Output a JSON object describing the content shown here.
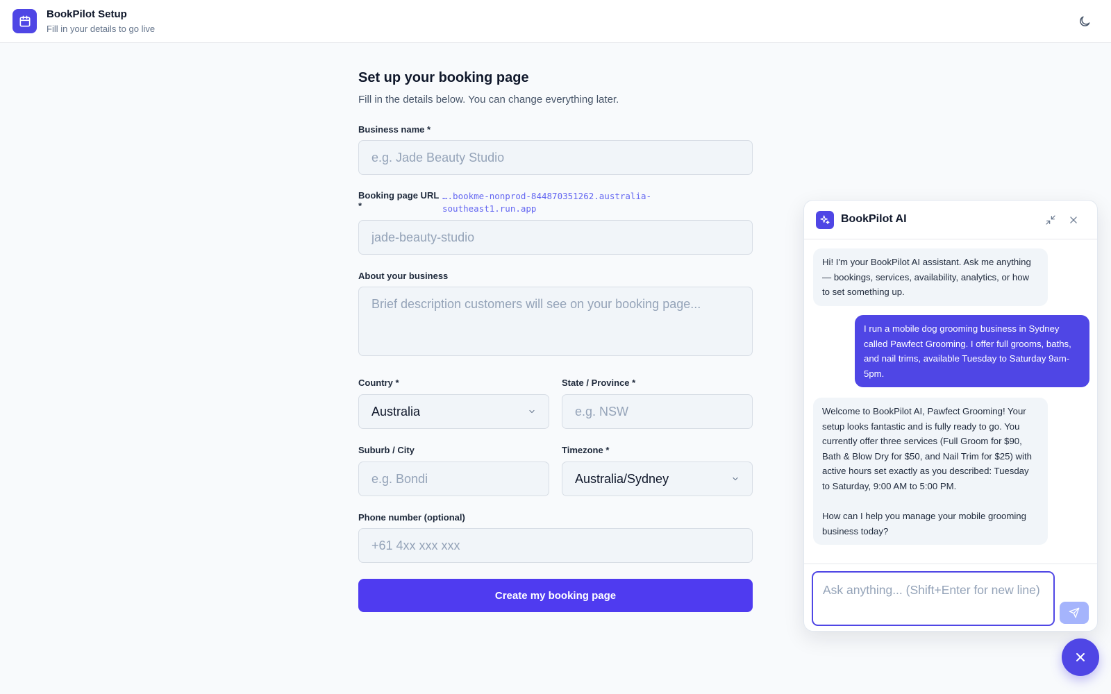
{
  "header": {
    "title": "BookPilot Setup",
    "subtitle": "Fill in your details to go live",
    "brand_icon": "calendar-icon",
    "theme_icon": "moon-icon"
  },
  "form": {
    "title": "Set up your booking page",
    "subtitle": "Fill in the details below. You can change everything later.",
    "business_name": {
      "label": "Business name *",
      "placeholder": "e.g. Jade Beauty Studio",
      "value": ""
    },
    "booking_url": {
      "label_line1": "Booking page URL",
      "label_line2": "*",
      "hint_line1": "….bookme-nonprod-844870351262.australia-",
      "hint_line2": "southeast1.run.app",
      "placeholder": "jade-beauty-studio",
      "value": ""
    },
    "about": {
      "label": "About your business",
      "placeholder": "Brief description customers will see on your booking page...",
      "value": ""
    },
    "country": {
      "label": "Country *",
      "value": "Australia"
    },
    "state": {
      "label": "State / Province *",
      "placeholder": "e.g. NSW",
      "value": ""
    },
    "suburb": {
      "label": "Suburb / City",
      "placeholder": "e.g. Bondi",
      "value": ""
    },
    "timezone": {
      "label": "Timezone *",
      "value": "Australia/Sydney"
    },
    "phone": {
      "label": "Phone number (optional)",
      "placeholder": "+61 4xx xxx xxx",
      "value": ""
    },
    "submit_label": "Create my booking page"
  },
  "chat": {
    "title": "BookPilot AI",
    "messages": [
      {
        "role": "assistant",
        "text": "Hi! I'm your BookPilot AI assistant. Ask me anything — bookings, services, availability, analytics, or how to set something up."
      },
      {
        "role": "user",
        "text": "I run a mobile dog grooming business in Sydney called Pawfect Grooming. I offer full grooms, baths, and nail trims, available Tuesday to Saturday 9am-5pm."
      },
      {
        "role": "assistant",
        "text": "Welcome to BookPilot AI, Pawfect Grooming! Your setup looks fantastic and is fully ready to go. You currently offer three services (Full Groom for $90, Bath & Blow Dry for $50, and Nail Trim for $25) with active hours set exactly as you described: Tuesday to Saturday, 9:00 AM to 5:00 PM.",
        "text2": "How can I help you manage your mobile grooming business today?"
      }
    ],
    "input_placeholder": "Ask anything... (Shift+Enter for new line)",
    "input_value": ""
  },
  "colors": {
    "accent": "#4f46e5",
    "cta": "#4f3bf0",
    "send_disabled": "#a5b4fc"
  }
}
